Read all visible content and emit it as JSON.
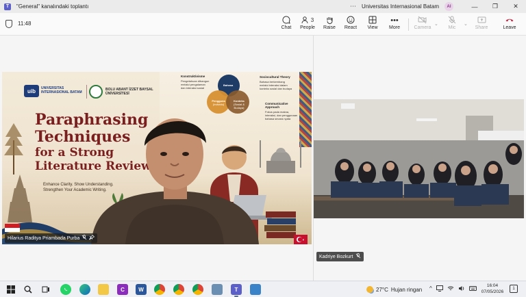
{
  "window": {
    "title": "\"General\" kanalındaki toplantı",
    "organization": "Universitas Internasional Batam",
    "avatar_initials": "AI",
    "minimize_glyph": "—",
    "maximize_glyph": "❐",
    "close_glyph": "✕"
  },
  "toolbar": {
    "timer": "11:48",
    "chat": "Chat",
    "people": "People",
    "people_count": "3",
    "raise": "Raise",
    "react": "React",
    "view": "View",
    "more": "More",
    "camera": "Camera",
    "mic": "Mic",
    "share": "Share",
    "leave": "Leave"
  },
  "presenter": {
    "name": "Hilarius Raditya Priambada Purba",
    "slide": {
      "uni_logo_text": "uib",
      "uni_name": "UNIVERSITAS INTERNASIONAL BATAM",
      "partner_name": "BOLU ABANT İZZET BAYSAL ÜNİVERSİTESİ",
      "title_line1": "Paraphrasing",
      "title_line2": "Techniques",
      "title_line3": "for a Strong",
      "title_line4": "Literature Review",
      "subtitle_line1": "Enhance Clarity. Show Understanding.",
      "subtitle_line2": "Strengthen Your Academic Writing.",
      "mindmap": {
        "left_heading": "Konstruktivisme",
        "left_text": "Pengetahuan dibangun melalui pengalaman dan interaksi sosial",
        "center_top": "Bahasa",
        "center_left": "Pengguna",
        "center_left_sub": "(Individu)",
        "center_right": "Konteks",
        "center_right_sub": "(Sosial & Budaya)",
        "right_heading": "Sociocultural Theory",
        "right_text": "Bahasa berkembang melalui interaksi dalam konteks sosial dan budaya",
        "right2_heading": "Communicative Approach",
        "right2_text": "Fokus pada makna, interaksi, dan penggunaan bahasa secara nyata"
      }
    }
  },
  "participant": {
    "name": "Kadriye Bozkurt"
  },
  "taskbar": {
    "weather_temp": "27°C",
    "weather_desc": "Hujan ringan",
    "time": "16:04",
    "date": "07/05/2026",
    "notifications": "1"
  },
  "colors": {
    "accent": "#5b5fc7",
    "leave": "#c4314b",
    "slide_title": "#7a1f1f"
  }
}
